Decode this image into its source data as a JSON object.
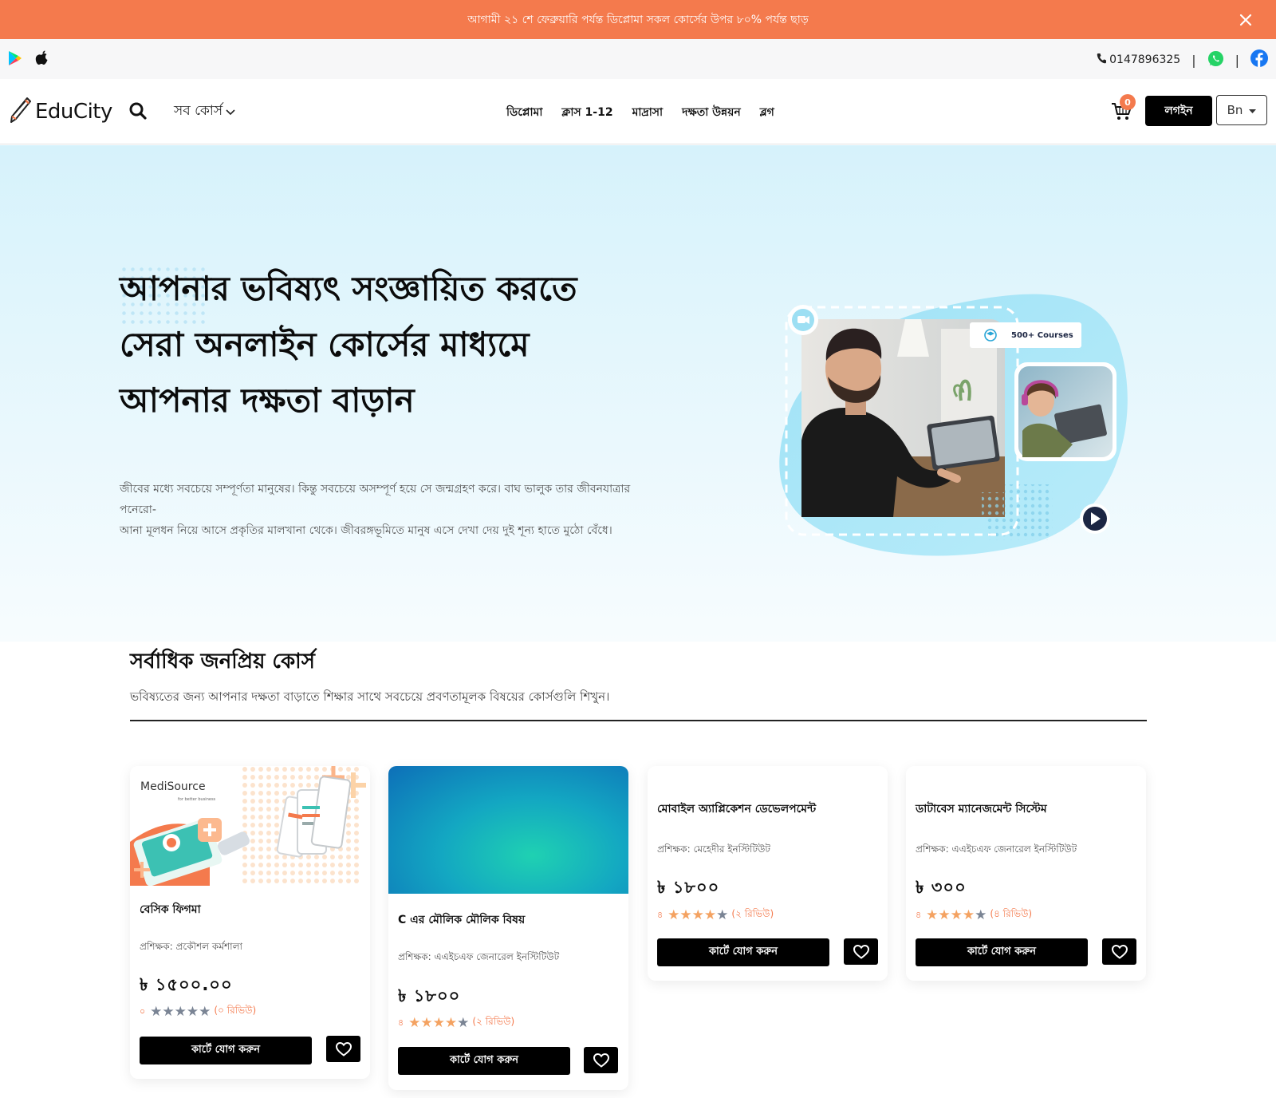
{
  "announcement": {
    "text": "আগামী ২১ শে ফেব্রুয়ারি পর্যন্ত ডিপ্লোমা সকল কোর্সের উপর ৮০% পর্যন্ত ছাড়"
  },
  "topbar": {
    "phone": "0147896325"
  },
  "nav": {
    "logo": "EduCity",
    "all_courses": "সব কোর্স",
    "links": [
      "ডিপ্লোমা",
      "ক্লাস 1-12",
      "মাদ্রাসা",
      "দক্ষতা উন্নয়ন",
      "ব্লগ"
    ],
    "cart_count": "0",
    "login": "লগইন",
    "language": "Bn"
  },
  "hero": {
    "title_lines": [
      "আপনার ভবিষ্যৎ সংজ্ঞায়িত করতে",
      "সেরা অনলাইন কোর্সের মাধ্যমে",
      "আপনার দক্ষতা বাড়ান"
    ],
    "description_lines": [
      "জীবের মধ্যে সবচেয়ে সম্পূর্ণতা মানুষের। কিন্তু সবচেয়ে অসম্পূর্ণ হয়ে সে জন্মগ্রহণ করে। বাঘ ভালুক তার জীবনযাত্রার পনেরো-",
      "আনা মূলধন নিয়ে আসে প্রকৃতির মালখানা থেকে। জীবরঙ্গভূমিতে মানুষ এসে দেখা দেয় দুই শূন্য হাতে মুঠো বেঁধে।"
    ],
    "courses_badge": "500+ Courses"
  },
  "popular": {
    "title": "সর্বাধিক জনপ্রিয় কোর্স",
    "subtitle": "ভবিষ্যতের জন্য আপনার দক্ষতা বাড়াতে শিক্ষার সাথে সবচেয়ে প্রবণতামূলক বিষয়ের কোর্সগুলি শিখুন।"
  },
  "courses": [
    {
      "title": "বেসিক ফিগমা",
      "instructor": "প্রশিক্ষক: প্রকৌশল কর্মশালা",
      "price": "৳ ১৫০০.০০",
      "rating_num": "০",
      "rating": 0,
      "reviews": "(০ রিভিউ)",
      "cart_label": "কার্টে যোগ করুন",
      "image_logo": "MediSource",
      "image_tagline": "for better business"
    },
    {
      "title": "C এর মৌলিক মৌলিক বিষয়",
      "instructor": "প্রশিক্ষক: এএইচএফ জেনারেল ইনস্টিটিউট",
      "price": "৳ ১৮০০",
      "rating_num": "৪",
      "rating": 4,
      "reviews": "(২ রিভিউ)",
      "cart_label": "কার্টে যোগ করুন"
    },
    {
      "title": "মোবাইল অ্যাপ্লিকেশন ডেভেলপমেন্ট",
      "instructor": "প্রশিক্ষক: মেহেদীর ইনস্টিটিউট",
      "price": "৳ ১৮০০",
      "rating_num": "৪",
      "rating": 4,
      "reviews": "(২ রিভিউ)",
      "cart_label": "কার্টে যোগ করুন"
    },
    {
      "title": "ডাটাবেস ম্যানেজমেন্ট সিস্টেম",
      "instructor": "প্রশিক্ষক: এএইচএফ জেনারেল ইনস্টিটিউট",
      "price": "৳ ৩০০",
      "rating_num": "৪",
      "rating": 4,
      "reviews": "(৪ রিভিউ)",
      "cart_label": "কার্টে যোগ করুন"
    }
  ],
  "icons": {
    "close": "close-icon",
    "play_store": "google-play-icon",
    "apple": "apple-icon",
    "phone": "phone-icon",
    "whatsapp": "whatsapp-icon",
    "facebook": "facebook-icon",
    "search": "search-icon",
    "cart": "cart-icon",
    "heart": "heart-icon",
    "video": "video-icon",
    "play": "play-icon",
    "star": "star-icon"
  },
  "colors": {
    "accent": "#f47a4d",
    "dark": "#000000",
    "hero_bg": "#d6f2fb",
    "star": "#f4a261",
    "whatsapp": "#25d366",
    "facebook": "#1877f2"
  }
}
